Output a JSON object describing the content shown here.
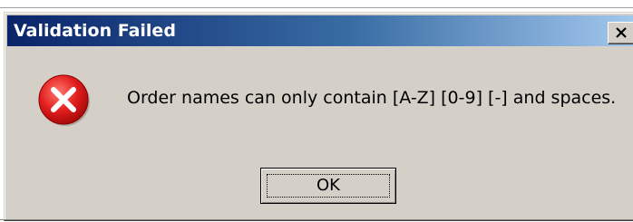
{
  "dialog": {
    "title": "Validation Failed",
    "message": "Order names can only contain [A-Z] [0-9] [-] and spaces.",
    "ok_label": "OK",
    "icon": "error-icon",
    "close_icon": "close-icon"
  },
  "colors": {
    "title_bar_start": "#0a246a",
    "title_bar_end": "#a6caf0",
    "dialog_face": "#d4d0c8",
    "error_red": "#e21d1d"
  }
}
